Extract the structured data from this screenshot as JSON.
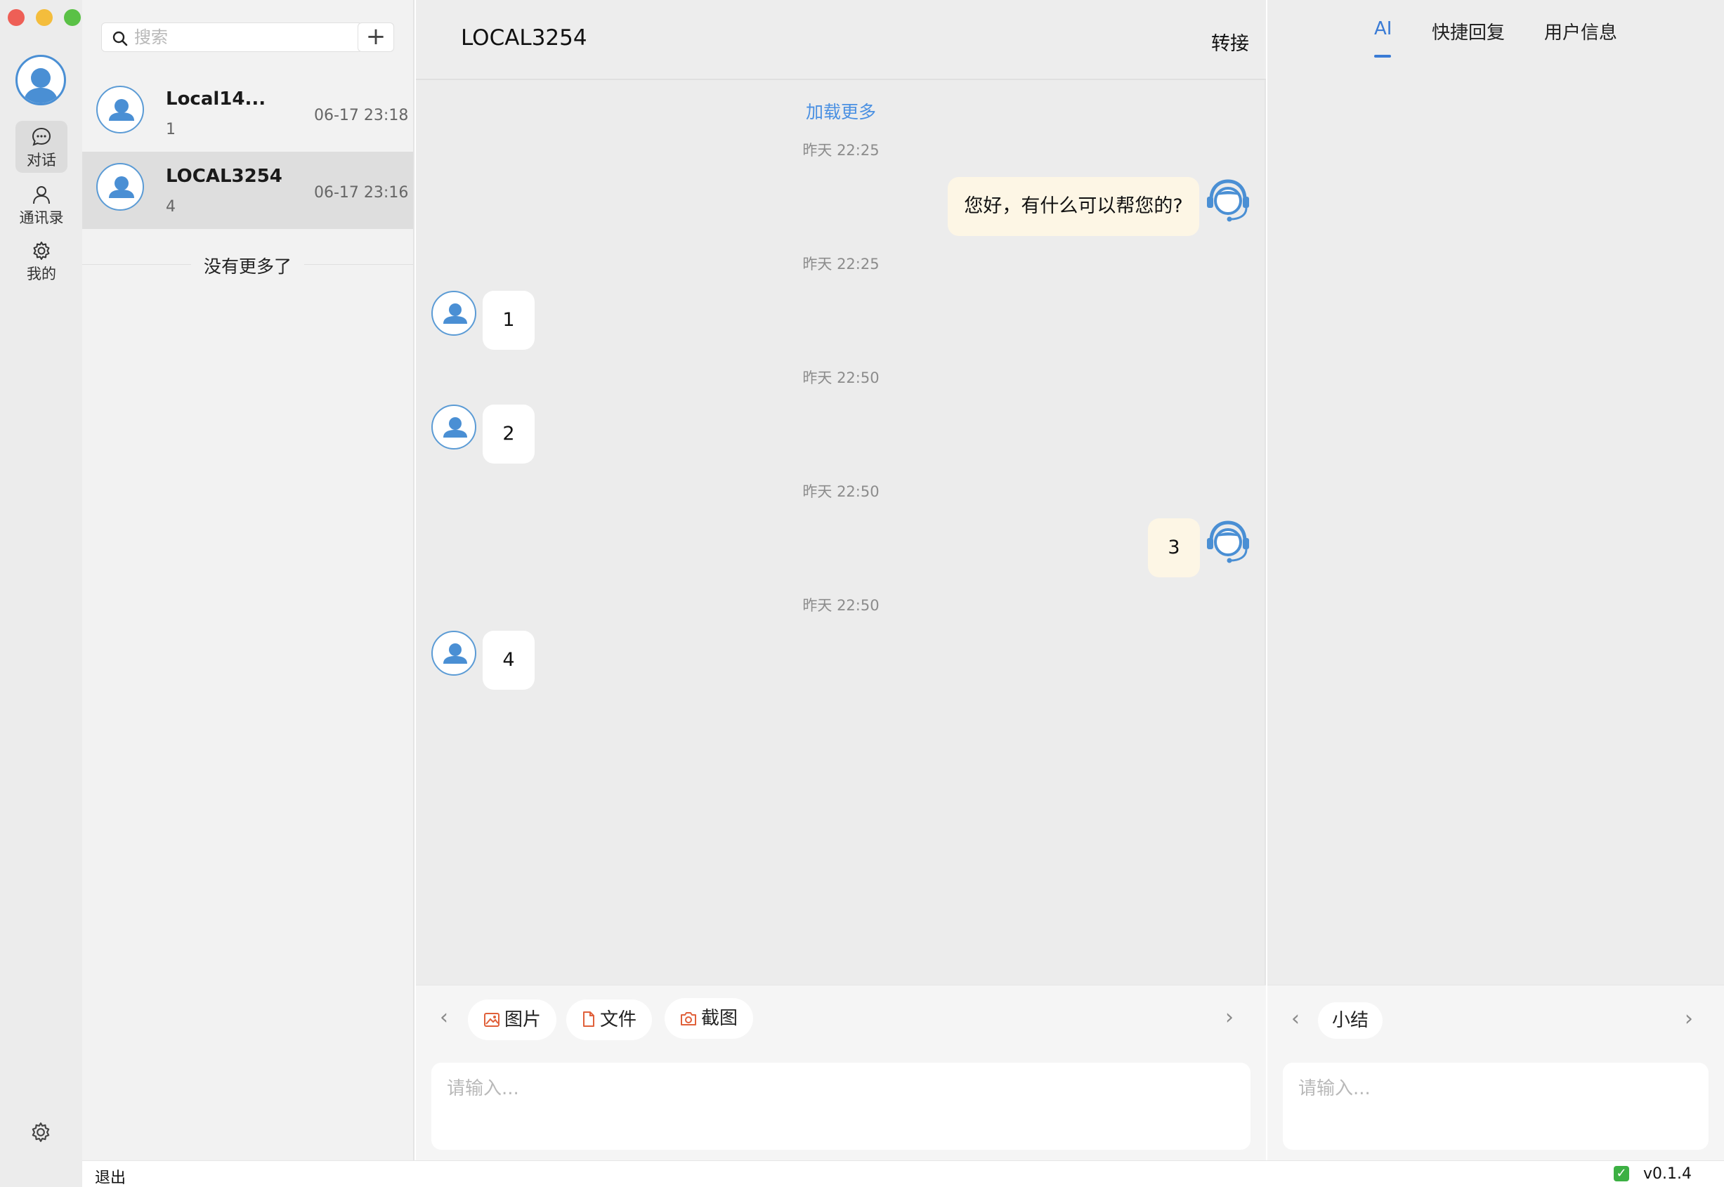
{
  "rail": {
    "nav": [
      {
        "label": "对话",
        "icon": "chat-bubble-icon"
      },
      {
        "label": "通讯录",
        "icon": "contact-icon"
      },
      {
        "label": "我的",
        "icon": "gear-icon"
      }
    ]
  },
  "list": {
    "search_placeholder": "搜索",
    "add_label": "+",
    "conversations": [
      {
        "name": "Local14...",
        "last_message": "1",
        "time": "06-17 23:18"
      },
      {
        "name": "LOCAL3254",
        "last_message": "4",
        "time": "06-17 23:16"
      }
    ],
    "no_more": "没有更多了"
  },
  "chat": {
    "title": "LOCAL3254",
    "transfer_label": "转接",
    "load_more": "加载更多",
    "messages": [
      {
        "time": "昨天 22:25",
        "from": "agent",
        "text": "您好，有什么可以帮您的?"
      },
      {
        "time": "昨天 22:25",
        "from": "user",
        "text": "1"
      },
      {
        "time": "昨天 22:50",
        "from": "user",
        "text": "2"
      },
      {
        "time": "昨天 22:50",
        "from": "agent",
        "text": "3"
      },
      {
        "time": "昨天 22:50",
        "from": "user",
        "text": "4"
      }
    ],
    "tools": [
      "图片",
      "文件",
      "截图"
    ],
    "input_placeholder": "请输入..."
  },
  "side": {
    "tabs": [
      "AI",
      "快捷回复",
      "用户信息"
    ],
    "active_tab": "AI",
    "chip": "小结",
    "input_placeholder": "请输入..."
  },
  "status": {
    "logout": "退出",
    "version": "v0.1.4"
  },
  "colors": {
    "accent": "#3a7bd5",
    "link": "#4a90e2",
    "agent_bubble": "#fdf6e5",
    "tool_icon": "#e0603a"
  }
}
